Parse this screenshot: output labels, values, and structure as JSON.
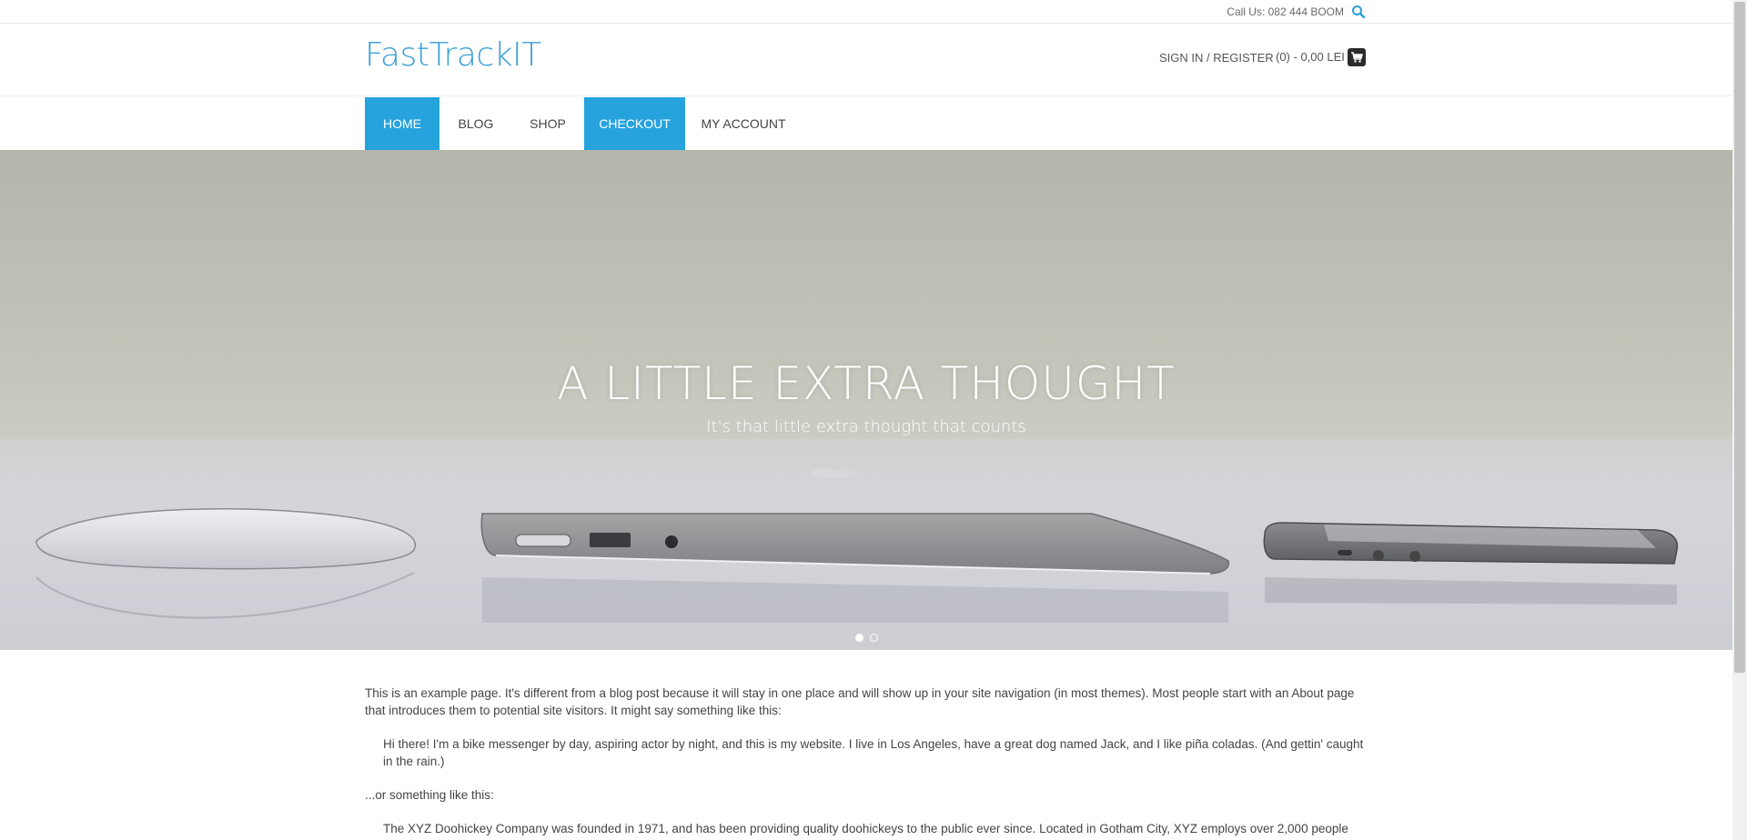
{
  "topbar": {
    "call": "Call Us: 082 444 BOOM",
    "search_icon": "search-icon"
  },
  "header": {
    "logo": "FastTrackIT",
    "signin": "SIGN IN / REGISTER",
    "cart": "(0) - 0,00 LEI",
    "cart_icon": "cart-icon"
  },
  "nav": {
    "items": [
      {
        "label": "HOME",
        "active": true
      },
      {
        "label": "BLOG",
        "active": false
      },
      {
        "label": "SHOP",
        "active": false
      },
      {
        "label": "CHECKOUT",
        "active": true
      },
      {
        "label": "MY ACCOUNT",
        "active": false
      }
    ]
  },
  "hero": {
    "title": "A LITTLE EXTRA THOUGHT",
    "subtitle": "It's that little extra thought that counts",
    "slide_count": 2,
    "current_slide": 1
  },
  "content": {
    "p1": "This is an example page. It's different from a blog post because it will stay in one place and will show up in your site navigation (in most themes). Most people start with an About page that introduces them to potential site visitors. It might say something like this:",
    "quote1": "Hi there! I'm a bike messenger by day, aspiring actor by night, and this is my website. I live in Los Angeles, have a great dog named Jack, and I like piña coladas. (And gettin' caught in the rain.)",
    "p2": "...or something like this:",
    "quote2": "The XYZ Doohickey Company was founded in 1971, and has been providing quality doohickeys to the public ever since. Located in Gotham City, XYZ employs over 2,000 people"
  },
  "colors": {
    "accent": "#26a3dd",
    "logo": "#3aa0d8"
  }
}
